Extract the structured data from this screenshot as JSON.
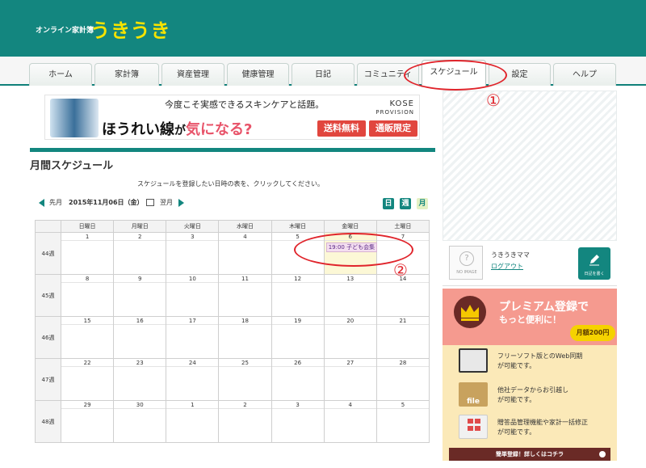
{
  "header": {
    "logo_small": "オンライン家計簿",
    "logo_big": "うきうき"
  },
  "nav": {
    "tabs": [
      {
        "label": "ホーム"
      },
      {
        "label": "家計簿"
      },
      {
        "label": "資産管理"
      },
      {
        "label": "健康管理"
      },
      {
        "label": "日記"
      },
      {
        "label": "コミュニティ"
      },
      {
        "label": "スケジュール",
        "active": true
      },
      {
        "label": "設定"
      },
      {
        "label": "ヘルプ"
      }
    ]
  },
  "ad": {
    "top_text": "今度こそ実感できるスキンケアと話題。",
    "main_text_a": "ほうれい線",
    "main_text_b": "が",
    "main_text_c": "気になる?",
    "brand": "KOSE",
    "brand_sub": "PROVISION",
    "pill1": "送料無料",
    "pill2": "通販限定"
  },
  "page": {
    "title": "月間スケジュール",
    "instruction": "スケジュールを登録したい日時の表を、クリックしてください。"
  },
  "month_nav": {
    "prev": "先月",
    "date": "2015年11月06日（金）",
    "next": "翌月"
  },
  "views": {
    "day": "日",
    "week": "週",
    "month": "月"
  },
  "calendar": {
    "headers": [
      "日曜日",
      "月曜日",
      "火曜日",
      "水曜日",
      "木曜日",
      "金曜日",
      "土曜日"
    ],
    "weeks": [
      {
        "label": "44週",
        "days": [
          "1",
          "2",
          "3",
          "4",
          "5",
          "6",
          "7"
        ]
      },
      {
        "label": "45週",
        "days": [
          "8",
          "9",
          "10",
          "11",
          "12",
          "13",
          "14"
        ]
      },
      {
        "label": "46週",
        "days": [
          "15",
          "16",
          "17",
          "18",
          "19",
          "20",
          "21"
        ]
      },
      {
        "label": "47週",
        "days": [
          "22",
          "23",
          "24",
          "25",
          "26",
          "27",
          "28"
        ]
      },
      {
        "label": "48週",
        "days": [
          "29",
          "30",
          "1",
          "2",
          "3",
          "4",
          "5"
        ]
      }
    ],
    "event": {
      "text": "19:00 子ども会集"
    }
  },
  "profile": {
    "username": "うきうきママ",
    "logout": "ログアウト",
    "avatar_label": "NO IMAGE",
    "diary_button": "日記を書く"
  },
  "promo": {
    "title1": "プレミアム登録で",
    "title2": "もっと便利に！",
    "price": "月額200円",
    "features": [
      {
        "line1": "フリーソフト版とのWeb同期",
        "line2": "が可能です。"
      },
      {
        "line1": "他社データからお引越し",
        "line2": "が可能です。"
      },
      {
        "line1": "贈答品管理機能や家計一括修正",
        "line2": "が可能です。"
      }
    ],
    "feature_icon_text": "file",
    "cta": "簡単登録！詳しくはコチラ"
  },
  "annotations": {
    "one": "①",
    "two": "②"
  },
  "colors": {
    "brand": "#13867f",
    "logo_yellow": "#f5e300",
    "annotation_red": "#e0242b",
    "promo_salmon": "#f59a8f"
  }
}
